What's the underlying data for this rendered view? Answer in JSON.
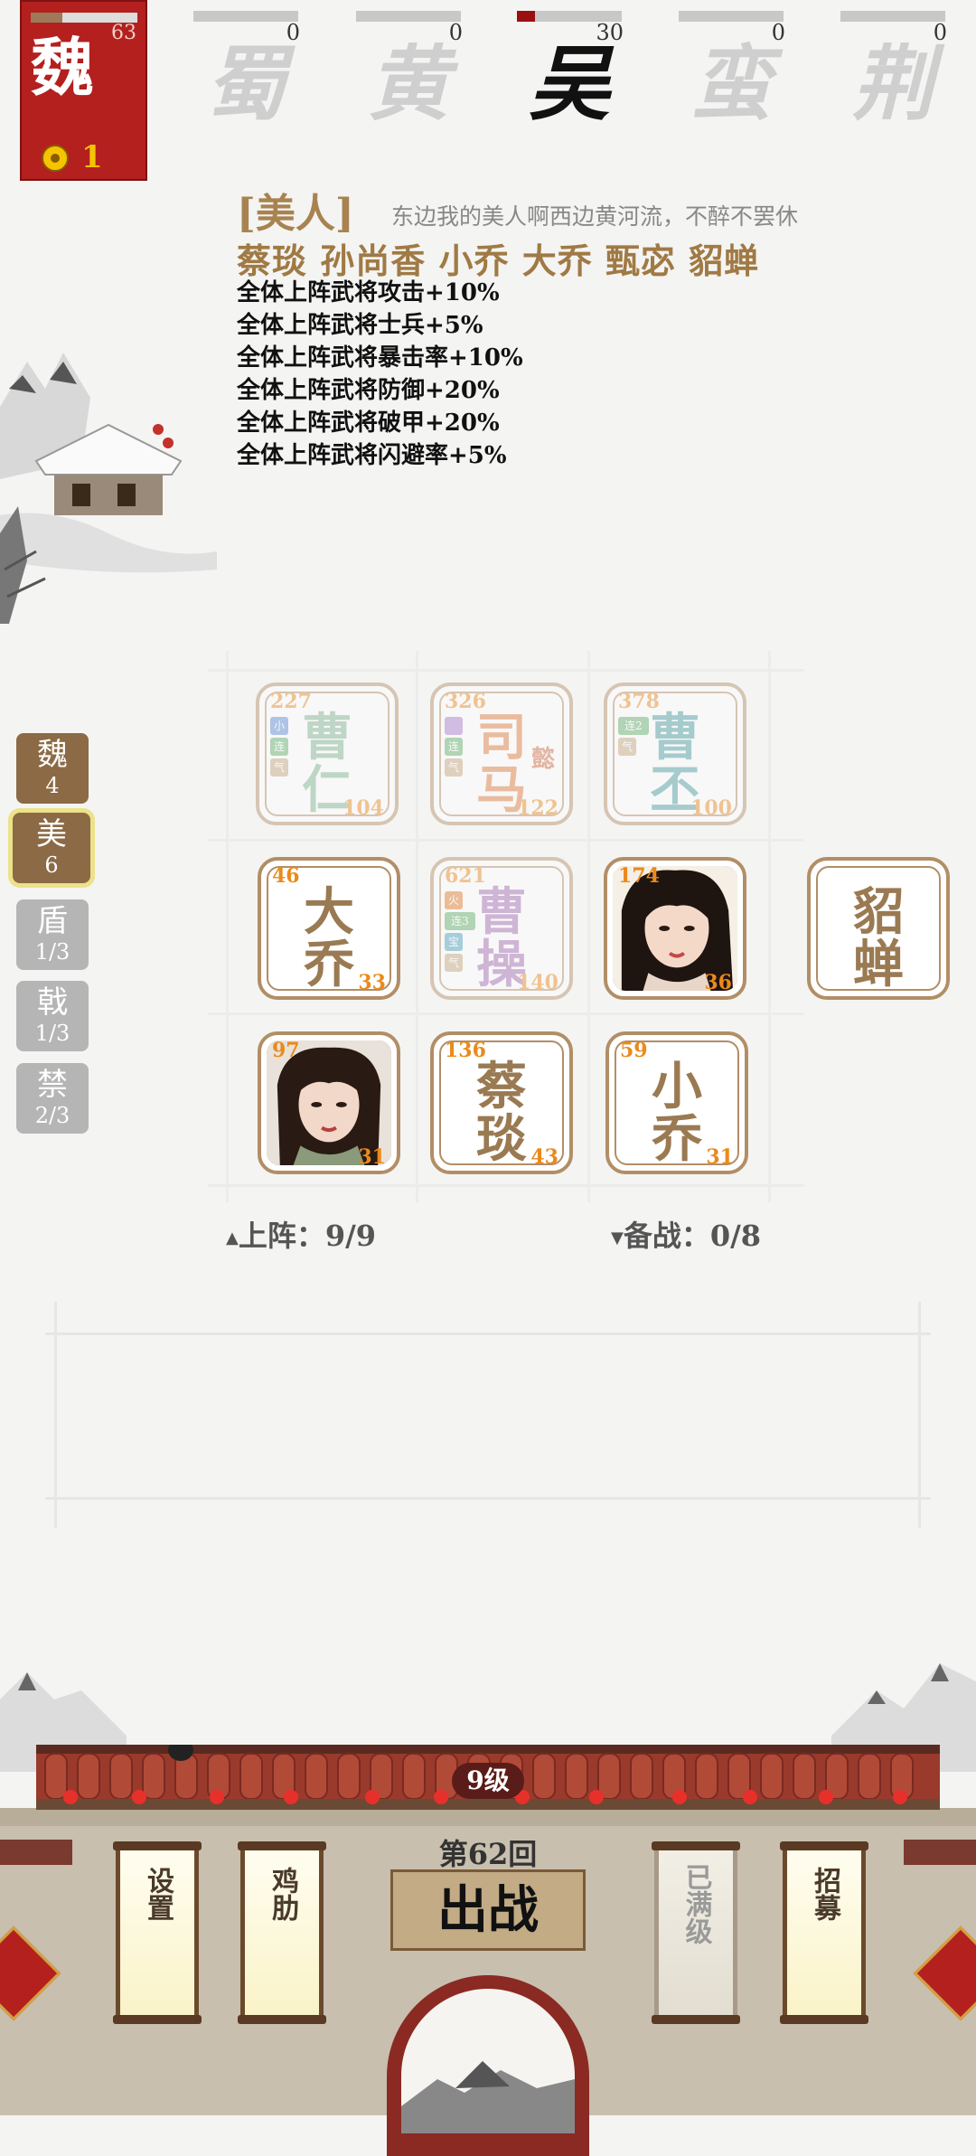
{
  "player": {
    "faction": "魏",
    "level": "63",
    "coins": "1",
    "hp_fraction": 0.3
  },
  "factions": [
    {
      "name": "蜀",
      "count": "0",
      "progress": 0,
      "active": false
    },
    {
      "name": "黄",
      "count": "0",
      "progress": 0,
      "active": false
    },
    {
      "name": "吴",
      "count": "30",
      "progress": 0.17,
      "active": true
    },
    {
      "name": "蛮",
      "count": "0",
      "progress": 0,
      "active": false
    },
    {
      "name": "荆",
      "count": "0",
      "progress": 0,
      "active": false
    }
  ],
  "bond": {
    "title": "[美人]",
    "quote": "东边我的美人啊西边黄河流，不醉不罢休",
    "members": "蔡琰 孙尚香 小乔 大乔 甄宓 貂蝉",
    "effects": [
      "全体上阵武将攻击+10%",
      "全体上阵武将士兵+5%",
      "全体上阵武将暴击率+10%",
      "全体上阵武将防御+20%",
      "全体上阵武将破甲+20%",
      "全体上阵武将闪避率+5%"
    ]
  },
  "tabs": [
    {
      "label": "魏",
      "count": "4"
    },
    {
      "label": "美",
      "count": "6"
    },
    {
      "label": "盾",
      "count": "1/3"
    },
    {
      "label": "戟",
      "count": "1/3"
    },
    {
      "label": "禁",
      "count": "2/3"
    }
  ],
  "cards": {
    "caoren": {
      "name1": "曹",
      "name2": "仁",
      "tl": "227",
      "br": "104",
      "badges": [
        "小",
        "连",
        "气"
      ]
    },
    "sima": {
      "name1": "司",
      "name2": "马",
      "extra": "懿",
      "tl": "326",
      "br": "122",
      "badges": [
        "",
        "连",
        "气"
      ]
    },
    "caopi": {
      "name1": "曹",
      "name2": "丕",
      "tl": "378",
      "br": "100",
      "badges": [
        "连2",
        "气"
      ]
    },
    "daqiao": {
      "name1": "大",
      "name2": "乔",
      "tl": "46",
      "br": "33"
    },
    "caocao": {
      "name1": "曹",
      "name2": "操",
      "tl": "621",
      "br": "140",
      "badges": [
        "火",
        "连3",
        "宝",
        "气"
      ]
    },
    "portrait1": {
      "tl": "174",
      "br": "36"
    },
    "diaochan": {
      "name1": "貂",
      "name2": "蝉"
    },
    "portrait2": {
      "tl": "97",
      "br": "31"
    },
    "caiyan": {
      "name1": "蔡",
      "name2": "琰",
      "tl": "136",
      "br": "43"
    },
    "xiaoqiao": {
      "name1": "小",
      "name2": "乔",
      "tl": "59",
      "br": "31"
    }
  },
  "status": {
    "deployed_label": "上阵：9/9",
    "reserve_label": "备战：0/8"
  },
  "building": {
    "level": "9级",
    "round": "第62回",
    "battle": "出战",
    "buttons": {
      "settings": "设置",
      "assist": "鸡肋",
      "maxed": "已满级",
      "recruit": "招募"
    }
  },
  "colors": {
    "accent": "#a88350",
    "active_red": "#b3201e",
    "card_border": "#b28e66"
  }
}
